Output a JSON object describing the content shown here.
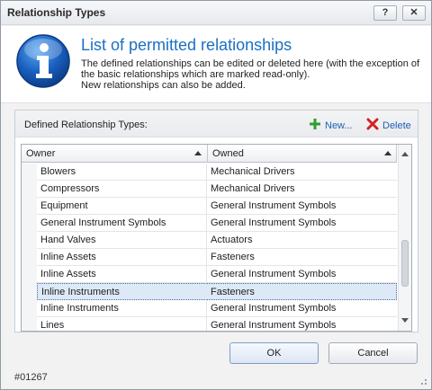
{
  "window": {
    "title": "Relationship Types",
    "help_label": "?",
    "close_label": "✕"
  },
  "header": {
    "title": "List of permitted relationships",
    "desc_line1": "The defined relationships can be edited or deleted here (with the exception of",
    "desc_line2": "the basic relationships which are marked read-only).",
    "desc_line3": "New relationships can also be added.",
    "icon": "info-icon"
  },
  "group": {
    "label": "Defined Relationship Types:",
    "new_label": "New...",
    "delete_label": "Delete",
    "new_icon": "plus-icon",
    "delete_icon": "red-x-icon"
  },
  "grid": {
    "columns": [
      "Owner",
      "Owned"
    ],
    "rows": [
      {
        "owner": "Blowers",
        "owned": "Mechanical Drivers"
      },
      {
        "owner": "Compressors",
        "owned": "Mechanical Drivers"
      },
      {
        "owner": "Equipment",
        "owned": "General Instrument Symbols"
      },
      {
        "owner": "General Instrument Symbols",
        "owned": "General Instrument Symbols"
      },
      {
        "owner": "Hand Valves",
        "owned": "Actuators"
      },
      {
        "owner": "Inline Assets",
        "owned": "Fasteners"
      },
      {
        "owner": "Inline Assets",
        "owned": "General Instrument Symbols"
      },
      {
        "owner": "Inline Instruments",
        "owned": "Fasteners"
      },
      {
        "owner": "Inline Instruments",
        "owned": "General Instrument Symbols"
      },
      {
        "owner": "Lines",
        "owned": "General Instrument Symbols"
      }
    ],
    "selected_row": 7
  },
  "footer": {
    "ok_label": "OK",
    "cancel_label": "Cancel",
    "status": "#01267"
  },
  "colors": {
    "accent": "#1a6fc4",
    "selection": "#dde9f7",
    "add_green": "#2e9e2e",
    "delete_red": "#d42020"
  }
}
